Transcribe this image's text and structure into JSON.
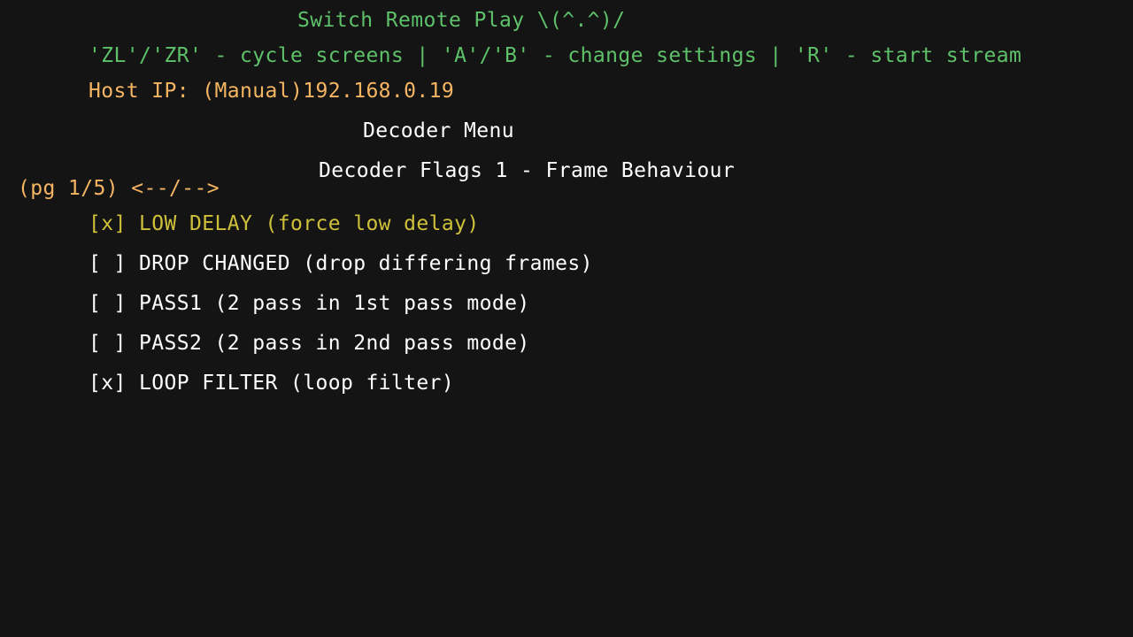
{
  "header": {
    "title": "Switch Remote Play \\(^.^)/",
    "controls": "'ZL'/'ZR' - cycle screens | 'A'/'B' - change settings | 'R' - start stream",
    "host_ip": "Host IP: (Manual)192.168.0.19"
  },
  "menu": {
    "title": "Decoder Menu",
    "page_heading": "Decoder Flags 1 - Frame Behaviour",
    "page_indicator": "(pg 1/5) <--/-->"
  },
  "flags": [
    {
      "text": "[x] LOW DELAY (force low delay)",
      "checked": true,
      "selected": true
    },
    {
      "text": "[ ] DROP CHANGED (drop differing frames)",
      "checked": false,
      "selected": false
    },
    {
      "text": "[ ] PASS1 (2 pass in 1st pass mode)",
      "checked": false,
      "selected": false
    },
    {
      "text": "[ ] PASS2 (2 pass in 2nd pass mode)",
      "checked": false,
      "selected": false
    },
    {
      "text": "[x] LOOP FILTER (loop filter)",
      "checked": true,
      "selected": false
    }
  ],
  "colors": {
    "background": "#141414",
    "title": "#5ec16a",
    "controls": "#5ec16a",
    "host_ip": "#f5b562",
    "page_indicator": "#f5b562",
    "text": "#ffffff",
    "selected": "#cfc03a"
  }
}
